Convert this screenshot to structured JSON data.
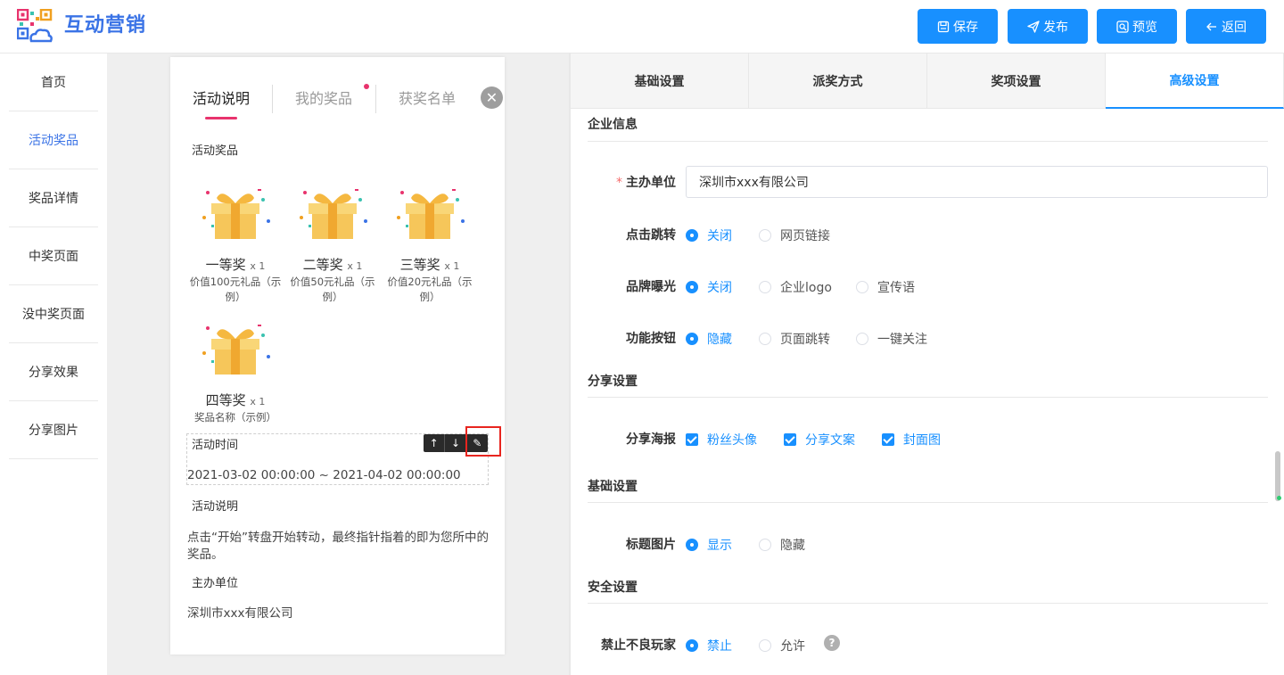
{
  "header": {
    "title": "互动营销",
    "buttons": {
      "save": "保存",
      "publish": "发布",
      "preview": "预览",
      "back": "返回"
    },
    "accent": "#1890ff"
  },
  "nav": {
    "items": [
      "首页",
      "活动奖品",
      "奖品详情",
      "中奖页面",
      "没中奖页面",
      "分享效果",
      "分享图片"
    ],
    "active_index": 1
  },
  "preview": {
    "tabs": [
      "活动说明",
      "我的奖品",
      "获奖名单"
    ],
    "prize_section": "活动奖品",
    "prizes": [
      {
        "name": "一等奖",
        "qty": "x 1",
        "desc": "价值100元礼品（示例）"
      },
      {
        "name": "二等奖",
        "qty": "x 1",
        "desc": "价值50元礼品（示例）"
      },
      {
        "name": "三等奖",
        "qty": "x 1",
        "desc": "价值20元礼品（示例）"
      },
      {
        "name": "四等奖",
        "qty": "x 1",
        "desc": "奖品名称（示例）"
      }
    ],
    "time_section": "活动时间",
    "time_value": "2021-03-02 00:00:00 ~ 2021-04-02 00:00:00",
    "desc_section": "活动说明",
    "desc_value": "点击“开始”转盘开始转动，最终指针指着的即为您所中的奖品。",
    "host_section": "主办单位",
    "host_value": "深圳市xxx有限公司"
  },
  "settings": {
    "tabs": [
      "基础设置",
      "派奖方式",
      "奖项设置",
      "高级设置"
    ],
    "active_tab": 3,
    "company_group": "企业信息",
    "host_label": "主办单位",
    "host_value": "深圳市xxx有限公司",
    "click_jump": {
      "label": "点击跳转",
      "options": [
        "关闭",
        "网页链接"
      ]
    },
    "brand_exposure": {
      "label": "品牌曝光",
      "options": [
        "关闭",
        "企业logo",
        "宣传语"
      ]
    },
    "function_button": {
      "label": "功能按钮",
      "options": [
        "隐藏",
        "页面跳转",
        "一键关注"
      ]
    },
    "share_group": "分享设置",
    "share_poster": {
      "label": "分享海报",
      "options": [
        "粉丝头像",
        "分享文案",
        "封面图"
      ]
    },
    "basic_group": "基础设置",
    "title_image": {
      "label": "标题图片",
      "options": [
        "显示",
        "隐藏"
      ]
    },
    "security_group": "安全设置",
    "block_players": {
      "label": "禁止不良玩家",
      "options": [
        "禁止",
        "允许"
      ]
    }
  }
}
